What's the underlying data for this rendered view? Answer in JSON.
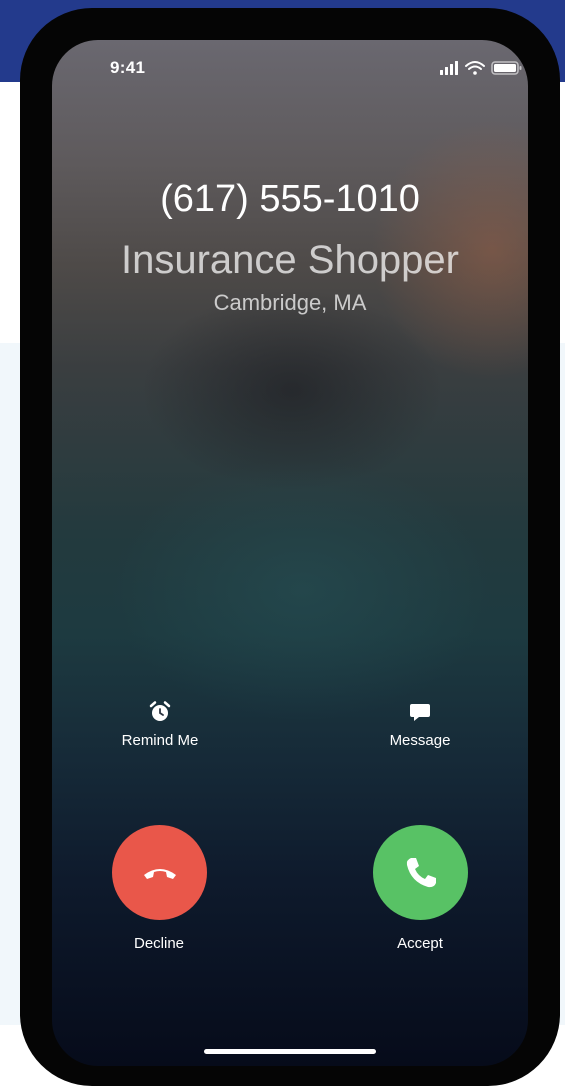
{
  "status_bar": {
    "time": "9:41",
    "icons": [
      "cellular-signal-icon",
      "wifi-icon",
      "battery-icon"
    ]
  },
  "caller": {
    "number": "(617) 555-1010",
    "name": "Insurance Shopper",
    "location": "Cambridge, MA"
  },
  "actions": {
    "remind_label": "Remind Me",
    "remind_icon": "alarm-clock-icon",
    "message_label": "Message",
    "message_icon": "message-bubble-icon"
  },
  "call_buttons": {
    "decline_label": "Decline",
    "decline_color": "#e9574a",
    "accept_label": "Accept",
    "accept_color": "#58c265"
  },
  "colors": {
    "page_top_band": "#233a8c",
    "page_panel": "#f1f7fb",
    "phone_frame": "#050505"
  }
}
